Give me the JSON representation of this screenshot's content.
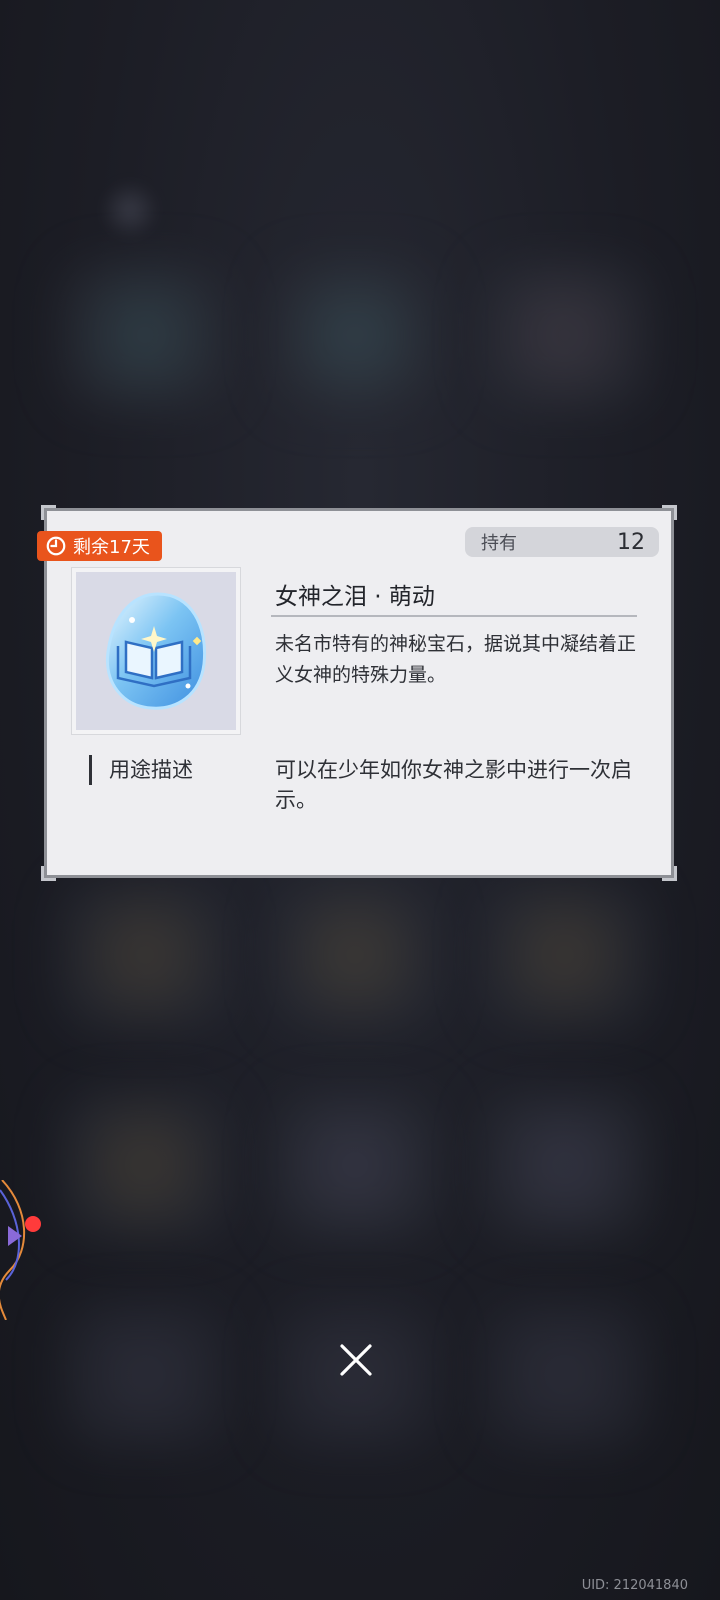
{
  "item": {
    "expiry_label": "剩余17天",
    "owned_label": "持有",
    "owned_count": "12",
    "name": "女神之泪 · 萌动",
    "description": "未名市特有的神秘宝石，据说其中凝结着正义女神的特殊力量。",
    "usage_label": "用途描述",
    "usage_text": "可以在少年如你女神之影中进行一次启示。",
    "icon": "gem-book-icon"
  },
  "footer": {
    "uid": "UID: 212041840"
  },
  "colors": {
    "badge": "#e9541c",
    "card_bg": "#eeeef1",
    "notification_dot": "#ff3b3b"
  }
}
